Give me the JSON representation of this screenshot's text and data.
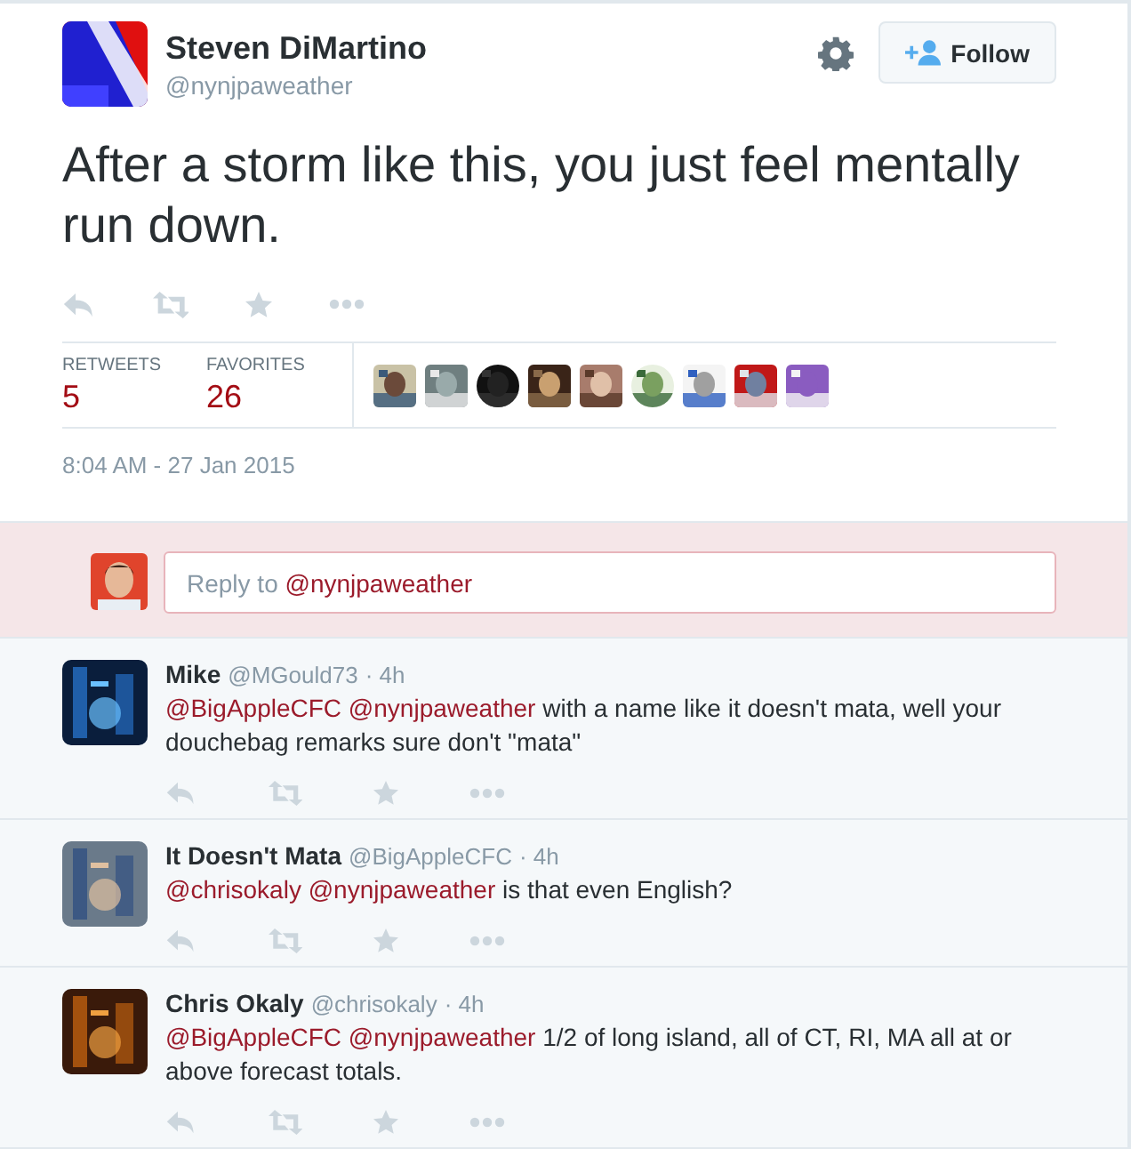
{
  "tweet": {
    "name": "Steven DiMartino",
    "handle": "@nynjpaweather",
    "follow_label": "Follow",
    "text": "After a storm like this, you just feel mentally run down.",
    "stats": [
      {
        "label": "RETWEETS",
        "count": "5"
      },
      {
        "label": "FAVORITES",
        "count": "26"
      }
    ],
    "timestamp": "8:04 AM - 27 Jan 2015"
  },
  "reply_box": {
    "prefix": "Reply to ",
    "mention": "@nynjpaweather"
  },
  "replies": [
    {
      "name": "Mike",
      "handle": "@MGould73",
      "time": "· 4h",
      "mentions": [
        "@BigAppleCFC",
        "@nynjpaweather"
      ],
      "text": "with a name like it doesn't mata, well your douchebag remarks  sure don't \"mata\""
    },
    {
      "name": "It Doesn't Mata",
      "handle": "@BigAppleCFC",
      "time": "· 4h",
      "mentions": [
        "@chrisokaly",
        "@nynjpaweather"
      ],
      "text": "is that even English?"
    },
    {
      "name": "Chris Okaly",
      "handle": "@chrisokaly",
      "time": "· 4h",
      "mentions": [
        "@BigAppleCFC",
        "@nynjpaweather"
      ],
      "text": "1/2 of long island, all of CT, RI, MA all at or above forecast totals."
    }
  ]
}
